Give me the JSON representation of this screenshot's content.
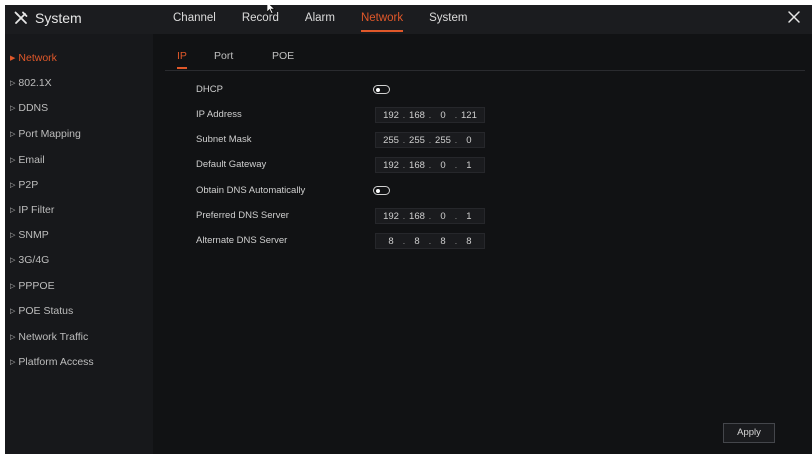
{
  "app": {
    "title": "System"
  },
  "topnav": {
    "tabs": [
      {
        "label": "Channel"
      },
      {
        "label": "Record"
      },
      {
        "label": "Alarm"
      },
      {
        "label": "Network"
      },
      {
        "label": "System"
      }
    ],
    "active_tab": "Network"
  },
  "sidebar": {
    "items": [
      {
        "label": "Network"
      },
      {
        "label": "802.1X"
      },
      {
        "label": "DDNS"
      },
      {
        "label": "Port Mapping"
      },
      {
        "label": "Email"
      },
      {
        "label": "P2P"
      },
      {
        "label": "IP Filter"
      },
      {
        "label": "SNMP"
      },
      {
        "label": "3G/4G"
      },
      {
        "label": "PPPOE"
      },
      {
        "label": "POE Status"
      },
      {
        "label": "Network Traffic"
      },
      {
        "label": "Platform Access"
      }
    ],
    "active_item": "Network"
  },
  "subtabs": {
    "items": [
      {
        "label": "IP"
      },
      {
        "label": "Port"
      },
      {
        "label": "POE"
      }
    ],
    "active": "IP"
  },
  "form": {
    "dhcp": {
      "label": "DHCP"
    },
    "ip_address": {
      "label": "IP Address",
      "octets": [
        "192",
        "168",
        "0",
        "121"
      ]
    },
    "subnet_mask": {
      "label": "Subnet Mask",
      "octets": [
        "255",
        "255",
        "255",
        "0"
      ]
    },
    "default_gateway": {
      "label": "Default Gateway",
      "octets": [
        "192",
        "168",
        "0",
        "1"
      ]
    },
    "obtain_dns": {
      "label": "Obtain DNS Automatically"
    },
    "preferred_dns": {
      "label": "Preferred DNS Server",
      "octets": [
        "192",
        "168",
        "0",
        "1"
      ]
    },
    "alternate_dns": {
      "label": "Alternate DNS Server",
      "octets": [
        "8",
        "8",
        "8",
        "8"
      ]
    }
  },
  "buttons": {
    "apply": "Apply"
  },
  "colors": {
    "accent": "#e0582a",
    "background": "#111214",
    "sidebar": "#17181b"
  }
}
